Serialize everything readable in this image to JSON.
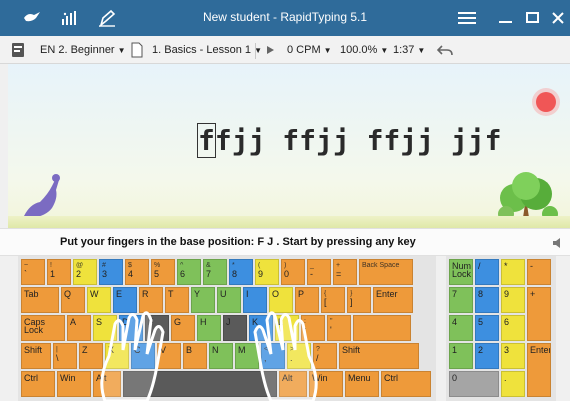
{
  "window": {
    "title": "New student - RapidTyping  5.1",
    "icons": [
      "bird-icon",
      "statistics-icon",
      "editor-icon",
      "menu-icon",
      "minimize-icon",
      "maximize-icon",
      "close-icon"
    ]
  },
  "toolbar": {
    "course": "EN 2. Beginner",
    "lesson": "1. Basics - Lesson 1",
    "speed": "0 CPM",
    "accuracy": "100.0%",
    "time": "1:37"
  },
  "lesson": {
    "cursor_char": "f",
    "text_rest": "fjj ffjj ffjj jjf"
  },
  "status": {
    "message": "Put your fingers in the base position:  F  J .  Start by pressing any key"
  },
  "keyboard": {
    "rows": [
      [
        {
          "m": "`",
          "s": "~",
          "c": "o"
        },
        {
          "m": "1",
          "s": "!",
          "c": "o"
        },
        {
          "m": "2",
          "s": "@",
          "c": "y"
        },
        {
          "m": "3",
          "s": "#",
          "c": "b"
        },
        {
          "m": "4",
          "s": "$",
          "c": "o"
        },
        {
          "m": "5",
          "s": "%",
          "c": "o"
        },
        {
          "m": "6",
          "s": "^",
          "c": "g"
        },
        {
          "m": "7",
          "s": "&",
          "c": "g"
        },
        {
          "m": "8",
          "s": "*",
          "c": "b"
        },
        {
          "m": "9",
          "s": "(",
          "c": "y"
        },
        {
          "m": "0",
          "s": ")",
          "c": "o"
        },
        {
          "m": "-",
          "s": "_",
          "c": "o"
        },
        {
          "m": "=",
          "s": "+",
          "c": "o"
        },
        {
          "m": "",
          "s": "Back Space",
          "c": "o"
        }
      ],
      [
        {
          "m": "Tab",
          "s": "",
          "c": "o"
        },
        {
          "m": "Q",
          "s": "",
          "c": "o"
        },
        {
          "m": "W",
          "s": "",
          "c": "y"
        },
        {
          "m": "E",
          "s": "",
          "c": "b"
        },
        {
          "m": "R",
          "s": "",
          "c": "o"
        },
        {
          "m": "T",
          "s": "",
          "c": "o"
        },
        {
          "m": "Y",
          "s": "",
          "c": "g"
        },
        {
          "m": "U",
          "s": "",
          "c": "g"
        },
        {
          "m": "I",
          "s": "",
          "c": "b"
        },
        {
          "m": "O",
          "s": "",
          "c": "y"
        },
        {
          "m": "P",
          "s": "",
          "c": "o"
        },
        {
          "m": "[",
          "s": "{",
          "c": "o"
        },
        {
          "m": "]",
          "s": "}",
          "c": "o"
        },
        {
          "m": "Enter",
          "s": "",
          "c": "o"
        }
      ],
      [
        {
          "m": "Caps Lock",
          "s": "",
          "c": "o"
        },
        {
          "m": "A",
          "s": "",
          "c": "o"
        },
        {
          "m": "S",
          "s": "",
          "c": "y"
        },
        {
          "m": "D",
          "s": "",
          "c": "b"
        },
        {
          "m": "F",
          "s": "",
          "c": "dk"
        },
        {
          "m": "G",
          "s": "",
          "c": "o"
        },
        {
          "m": "H",
          "s": "",
          "c": "g"
        },
        {
          "m": "J",
          "s": "",
          "c": "dk"
        },
        {
          "m": "K",
          "s": "",
          "c": "b"
        },
        {
          "m": "L",
          "s": "",
          "c": "y"
        },
        {
          "m": ";",
          "s": ":",
          "c": "o"
        },
        {
          "m": "'",
          "s": "\"",
          "c": "o"
        },
        {
          "m": "",
          "s": "",
          "c": "o"
        }
      ],
      [
        {
          "m": "Shift",
          "s": "",
          "c": "o"
        },
        {
          "m": "\\",
          "s": "|",
          "c": "o"
        },
        {
          "m": "Z",
          "s": "",
          "c": "o"
        },
        {
          "m": "X",
          "s": "",
          "c": "y"
        },
        {
          "m": "C",
          "s": "",
          "c": "b"
        },
        {
          "m": "V",
          "s": "",
          "c": "o"
        },
        {
          "m": "B",
          "s": "",
          "c": "o"
        },
        {
          "m": "N",
          "s": "",
          "c": "g"
        },
        {
          "m": "M",
          "s": "",
          "c": "g"
        },
        {
          "m": ",",
          "s": "<",
          "c": "b"
        },
        {
          "m": ".",
          "s": ">",
          "c": "y"
        },
        {
          "m": "/",
          "s": "?",
          "c": "o"
        },
        {
          "m": "Shift",
          "s": "",
          "c": "o"
        }
      ],
      [
        {
          "m": "Ctrl",
          "s": "",
          "c": "o"
        },
        {
          "m": "Win",
          "s": "",
          "c": "o"
        },
        {
          "m": "Alt",
          "s": "",
          "c": "o"
        },
        {
          "m": "",
          "s": "",
          "c": "dk"
        },
        {
          "m": "Alt",
          "s": "",
          "c": "o"
        },
        {
          "m": "Win",
          "s": "",
          "c": "o"
        },
        {
          "m": "Menu",
          "s": "",
          "c": "o"
        },
        {
          "m": "Ctrl",
          "s": "",
          "c": "o"
        }
      ]
    ],
    "numpad": [
      [
        {
          "m": "Num Lock",
          "c": "g"
        },
        {
          "m": "/",
          "c": "b"
        },
        {
          "m": "*",
          "c": "y"
        },
        {
          "m": "-",
          "c": "o"
        }
      ],
      [
        {
          "m": "7",
          "c": "g"
        },
        {
          "m": "8",
          "c": "b"
        },
        {
          "m": "9",
          "c": "y"
        },
        {
          "m": "+",
          "c": "o"
        }
      ],
      [
        {
          "m": "4",
          "c": "g"
        },
        {
          "m": "5",
          "c": "b"
        },
        {
          "m": "6",
          "c": "y"
        }
      ],
      [
        {
          "m": "1",
          "c": "g"
        },
        {
          "m": "2",
          "c": "b"
        },
        {
          "m": "3",
          "c": "y"
        },
        {
          "m": "Enter",
          "c": "o"
        }
      ],
      [
        {
          "m": "0",
          "c": "gr"
        },
        {
          "m": ".",
          "c": "y"
        }
      ]
    ]
  }
}
